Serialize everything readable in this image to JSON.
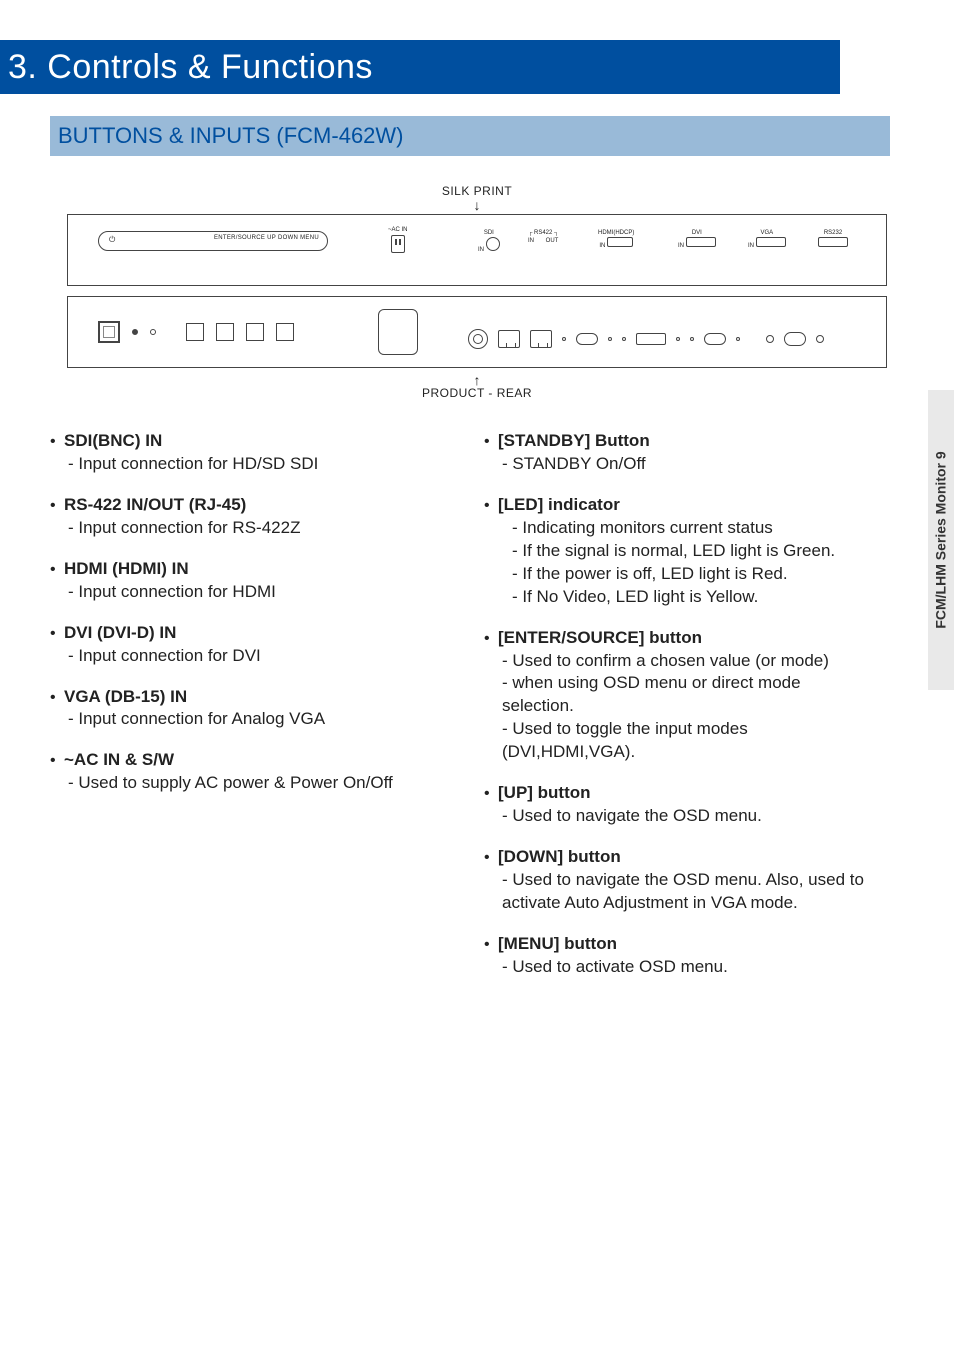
{
  "header": {
    "title": "3. Controls & Functions"
  },
  "subheader": {
    "title": "BUTTONS & INPUTS (FCM-462W)"
  },
  "diagram": {
    "silk_label": "SILK PRINT",
    "rear_label": "PRODUCT - REAR",
    "pill_power_icon": "⏻",
    "pill_labels": "ENTER/SOURCE   UP        DOWN     MENU",
    "acin": "~AC IN",
    "ports": {
      "sdi": "SDI",
      "sdi_in": "IN",
      "rs422": "RS422",
      "rs422_in": "IN",
      "rs422_out": "OUT",
      "hdmi": "HDMI(HDCP)",
      "hdmi_in": "IN",
      "dvi": "DVI",
      "dvi_in": "IN",
      "vga": "VGA",
      "vga_in": "IN",
      "rs232": "RS232"
    }
  },
  "left": [
    {
      "hd": "SDI(BNC)  IN",
      "lines": [
        "- Input connection for HD/SD SDI"
      ]
    },
    {
      "hd": "RS-422 IN/OUT (RJ-45)",
      "lines": [
        "- Input connection for RS-422Z"
      ]
    },
    {
      "hd": "HDMI (HDMI)  IN",
      "lines": [
        "- Input connection for HDMI"
      ]
    },
    {
      "hd": "DVI (DVI-D)  IN",
      "lines": [
        "- Input connection for DVI"
      ]
    },
    {
      "hd": "VGA (DB-15)  IN",
      "lines": [
        "- Input connection for Analog VGA"
      ]
    },
    {
      "hd": "~AC IN & S/W",
      "lines": [
        "- Used to supply AC power & Power On/Off"
      ]
    }
  ],
  "right": [
    {
      "hd": "[STANDBY]  Button",
      "lines": [
        "- STANDBY On/Off"
      ]
    },
    {
      "hd": "[LED] indicator",
      "lines": [
        "- Indicating monitors current status",
        "- If the signal is normal, LED light is Green.",
        "- If the power is off, LED light is Red.",
        "- If No Video, LED light is Yellow."
      ],
      "indent": true
    },
    {
      "hd": "[ENTER/SOURCE] button",
      "lines": [
        "- Used to confirm a chosen value (or mode)",
        "- when using OSD menu or direct mode",
        "  selection.",
        "- Used to toggle the input modes",
        "  (DVI,HDMI,VGA)."
      ]
    },
    {
      "hd": "[UP] button",
      "lines": [
        "- Used to navigate the OSD menu."
      ]
    },
    {
      "hd": "[DOWN] button",
      "lines": [
        "- Used to navigate the OSD menu. Also, used to",
        "  activate Auto Adjustment in VGA mode."
      ]
    },
    {
      "hd": "[MENU] button",
      "lines": [
        "- Used to activate OSD menu."
      ]
    }
  ],
  "side": {
    "label": "FCM/LHM Series Monitor 9"
  }
}
